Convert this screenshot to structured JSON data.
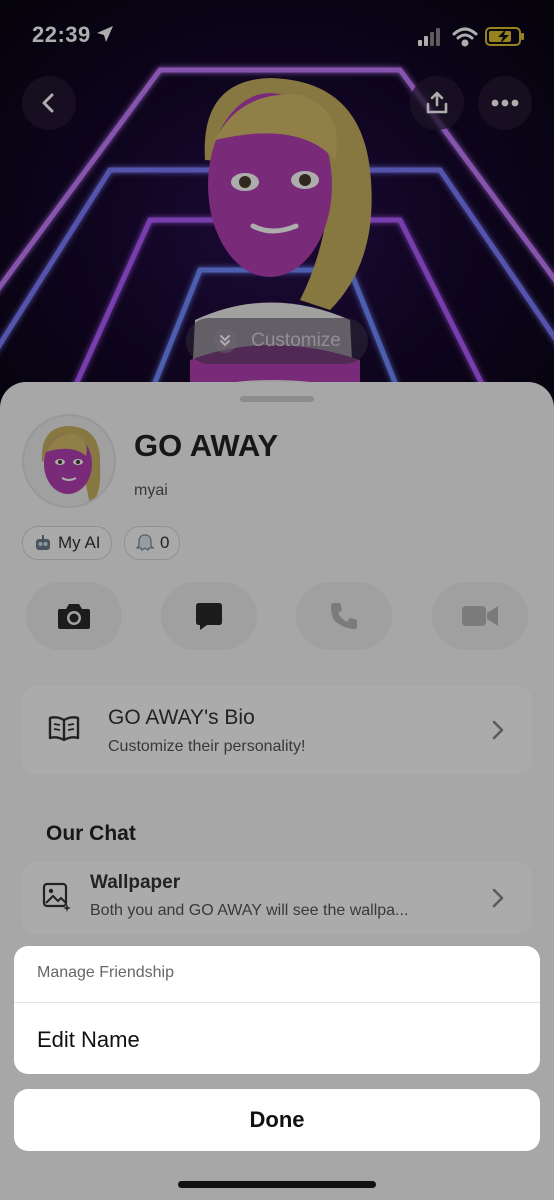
{
  "status_bar": {
    "time": "22:39"
  },
  "hero": {
    "customize_label": "Customize"
  },
  "profile": {
    "display_name": "GO AWAY",
    "username": "myai",
    "chips": [
      {
        "label": "My AI"
      },
      {
        "label": "0"
      }
    ]
  },
  "bio_card": {
    "title": "GO AWAY's Bio",
    "subtitle": "Customize their personality!"
  },
  "our_chat": {
    "title": "Our Chat",
    "wallpaper": {
      "title": "Wallpaper",
      "subtitle": "Both you and GO AWAY will see the wallpa..."
    }
  },
  "action_sheet": {
    "header": "Manage Friendship",
    "items": [
      {
        "label": "Edit Name"
      }
    ],
    "done_label": "Done"
  },
  "colors": {
    "sheet_bg": "#f6f6f6",
    "neon_purple": "#b25cff",
    "avatar_skin": "#b33fb3",
    "hair": "#c8b060"
  }
}
